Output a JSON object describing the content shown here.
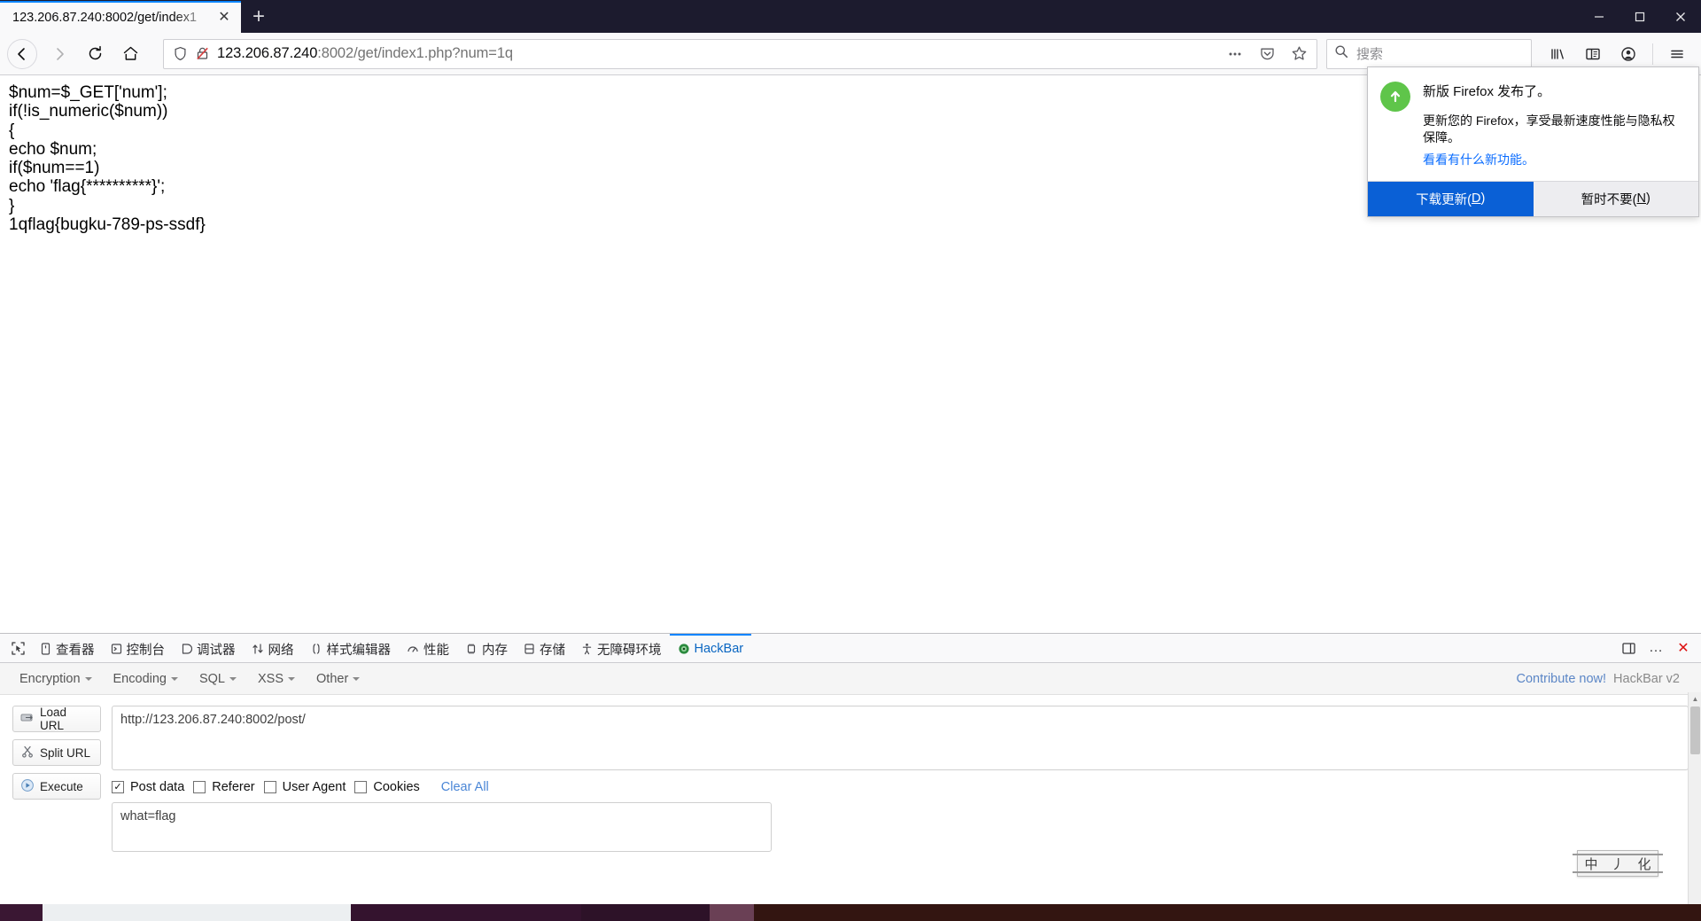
{
  "window": {
    "tab_title": "123.206.87.240:8002/get/index1",
    "new_tab_label": "+",
    "close_tab_label": "✕",
    "minimize_label": "minimize",
    "maximize_label": "maximize",
    "close_label": "close"
  },
  "toolbar": {
    "back_label": "back",
    "forward_label": "forward",
    "reload_label": "reload",
    "home_label": "home",
    "url_host": "123.206.87.240",
    "url_rest": ":8002/get/index1.php?num=1q",
    "page_actions_label": "…",
    "pocket_label": "Save to Pocket",
    "bookmark_label": "Bookmark",
    "library_label": "Library",
    "sidebar_label": "Sidebars",
    "account_label": "Account",
    "menu_label": "Open menu"
  },
  "search": {
    "placeholder": "搜索",
    "icon": "search-icon"
  },
  "page": {
    "lines": [
      "$num=$_GET['num'];",
      "if(!is_numeric($num))",
      "{",
      "echo $num;",
      "if($num==1)",
      "echo 'flag{**********}';",
      "}",
      "1qflag{bugku-789-ps-ssdf}"
    ]
  },
  "update_popup": {
    "icon": "update-arrow-icon",
    "title": "新版 Firefox 发布了。",
    "description": "更新您的 Firefox，享受最新速度性能与隐私权保障。",
    "link": "看看有什么新功能。",
    "primary_button": "下载更新(D)",
    "primary_button_text": "下载更新(",
    "primary_button_key": "D",
    "secondary_button": "暂时不要(N)",
    "secondary_button_text": "暂时不要(",
    "secondary_button_key": "N",
    "primary_color": "#0a60d6"
  },
  "devtools": {
    "picker_label": "element-picker",
    "tabs": [
      {
        "label": "查看器",
        "icon": "inspector-icon",
        "active": false
      },
      {
        "label": "控制台",
        "icon": "console-icon",
        "active": false
      },
      {
        "label": "调试器",
        "icon": "debugger-icon",
        "active": false
      },
      {
        "label": "网络",
        "icon": "network-icon",
        "active": false
      },
      {
        "label": "样式编辑器",
        "icon": "style-editor-icon",
        "active": false
      },
      {
        "label": "性能",
        "icon": "performance-icon",
        "active": false
      },
      {
        "label": "内存",
        "icon": "memory-icon",
        "active": false
      },
      {
        "label": "存储",
        "icon": "storage-icon",
        "active": false
      },
      {
        "label": "无障碍环境",
        "icon": "accessibility-icon",
        "active": false
      },
      {
        "label": "HackBar",
        "icon": "hackbar-icon",
        "active": true
      }
    ],
    "dock_label": "dock-toggle",
    "more_label": "…",
    "close_label": "✕"
  },
  "hackbar": {
    "menus": [
      {
        "label": "Encryption"
      },
      {
        "label": "Encoding"
      },
      {
        "label": "SQL"
      },
      {
        "label": "XSS"
      },
      {
        "label": "Other"
      }
    ],
    "contribute": "Contribute now!",
    "version": "HackBar v2",
    "buttons": [
      {
        "label": "Load URL",
        "icon": "load-url-icon"
      },
      {
        "label": "Split URL",
        "icon": "split-url-icon"
      },
      {
        "label": "Execute",
        "icon": "execute-icon"
      }
    ],
    "url_value": "http://123.206.87.240:8002/post/",
    "url_placeholder": "",
    "checkboxes": [
      {
        "label": "Post data",
        "checked": true
      },
      {
        "label": "Referer",
        "checked": false
      },
      {
        "label": "User Agent",
        "checked": false
      },
      {
        "label": "Cookies",
        "checked": false
      }
    ],
    "checked_mark": "✓",
    "clear_all": "Clear All",
    "post_data_value": "what=flag"
  },
  "ime": {
    "mode": "中",
    "glyph2": "丿",
    "glyph3": "化"
  }
}
